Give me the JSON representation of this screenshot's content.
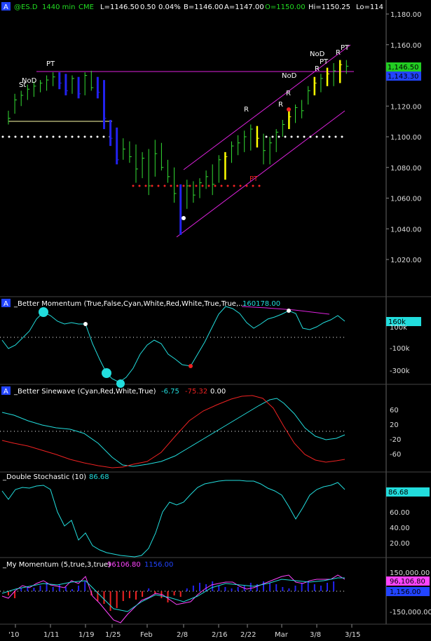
{
  "header": {
    "icon_letter": "A",
    "symbol": "@ES.D",
    "interval": "1440 min",
    "exchange": "CME",
    "last": "L=1146.50",
    "change": "0.50",
    "change_pct": "0.04%",
    "bid": "B=1146.00",
    "ask": "A=1147.00",
    "open": "O=1150.00",
    "high": "Hi=1150.25",
    "low": "Lo=114"
  },
  "colors": {
    "background": "#000000",
    "up_bar": "#33dd33",
    "down_bar": "#2222ee",
    "yellow_bar": "#ffff00",
    "channel": "#dd22dd",
    "cyan": "#22dddd",
    "red": "#ee2222",
    "magenta": "#ff44ff",
    "axis_text": "#dddddd",
    "blue_label": "#2244ff"
  },
  "price_axis": {
    "ticks": [
      "1,180.00",
      "1,160.00",
      "1,140.00",
      "1,120.00",
      "1,100.00",
      "1,080.00",
      "1,060.00",
      "1,040.00",
      "1,020.00"
    ]
  },
  "price_labels": {
    "last": "1,146.50",
    "second": "1,143.30"
  },
  "x_axis": {
    "ticks": [
      "'10",
      "1/11",
      "1/19",
      "1/25",
      "Feb",
      "2/8",
      "2/16",
      "2/22",
      "Mar",
      "3/8",
      "3/15"
    ]
  },
  "annotations": {
    "st": "St",
    "nod": "NoD",
    "pt": "PT",
    "r": "R",
    "pt_red": "PT"
  },
  "panels": {
    "momentum": {
      "title": "_Better Momentum (True,False,Cyan,White,Red,White,True,True,...",
      "value": "160178.00",
      "axis": [
        "100k",
        "-100k",
        "-300k"
      ],
      "last_label": "160k"
    },
    "sinewave": {
      "title": "_Better Sinewave (Cyan,Red,White,True)",
      "v1": "-6.75",
      "v2": "-75.32",
      "v3": "0.00",
      "axis": [
        "60",
        "20",
        "-20",
        "-60"
      ]
    },
    "stochastic": {
      "title": "_Double Stochastic (10)",
      "value": "86.68",
      "axis": [
        "60.00",
        "40.00",
        "20.00"
      ],
      "last_label": "86.68"
    },
    "my_momentum": {
      "title": "_My Momentum (5,true,3,true)",
      "v1": "96106.80",
      "v2": "1156.00",
      "axis": [
        "150,000.00",
        "-150,000.00"
      ],
      "label1": "96,106.80",
      "label2": "1,156.00"
    }
  },
  "chart_data": {
    "type": "candlestick",
    "x": [
      "'10",
      "",
      "",
      "",
      "",
      "",
      "",
      "1/11",
      "",
      "",
      "",
      "",
      "",
      "1/19",
      "",
      "",
      "",
      "1/25",
      "",
      "",
      "",
      "",
      "",
      "",
      "",
      "Feb",
      "",
      "",
      "",
      "",
      "2/8",
      "",
      "",
      "",
      "",
      "",
      "2/16",
      "",
      "",
      "",
      "2/22",
      "",
      "",
      "",
      "",
      "Mar",
      "",
      "",
      "",
      "3/8",
      "",
      "",
      "",
      "3/15"
    ],
    "bars": [
      [
        1117,
        1108,
        1112,
        "g"
      ],
      [
        1128,
        1115,
        1124,
        "g"
      ],
      [
        1130,
        1120,
        1127,
        "g"
      ],
      [
        1134,
        1124,
        1131,
        "g"
      ],
      [
        1136,
        1126,
        1133,
        "g"
      ],
      [
        1137,
        1129,
        1135,
        "g"
      ],
      [
        1140,
        1130,
        1137,
        "g"
      ],
      [
        1142,
        1133,
        1139,
        "g"
      ],
      [
        1142,
        1131,
        1135,
        "b"
      ],
      [
        1141,
        1127,
        1130,
        "b"
      ],
      [
        1140,
        1128,
        1138,
        "g"
      ],
      [
        1139,
        1125,
        1128,
        "b"
      ],
      [
        1142,
        1127,
        1140,
        "g"
      ],
      [
        1143,
        1130,
        1132,
        "g"
      ],
      [
        1139,
        1125,
        1129,
        "b"
      ],
      [
        1137,
        1105,
        1112,
        "b"
      ],
      [
        1111,
        1094,
        1099,
        "b"
      ],
      [
        1106,
        1082,
        1085,
        "b"
      ],
      [
        1099,
        1085,
        1092,
        "g"
      ],
      [
        1097,
        1083,
        1087,
        "g"
      ],
      [
        1095,
        1070,
        1079,
        "g"
      ],
      [
        1090,
        1073,
        1086,
        "g"
      ],
      [
        1092,
        1062,
        1068,
        "g"
      ],
      [
        1098,
        1074,
        1089,
        "g"
      ],
      [
        1096,
        1078,
        1080,
        "g"
      ],
      [
        1085,
        1070,
        1074,
        "g"
      ],
      [
        1080,
        1057,
        1063,
        "g"
      ],
      [
        1069,
        1036,
        1046,
        "b"
      ],
      [
        1072,
        1053,
        1068,
        "g"
      ],
      [
        1071,
        1057,
        1062,
        "g"
      ],
      [
        1073,
        1060,
        1070,
        "g"
      ],
      [
        1078,
        1066,
        1074,
        "g"
      ],
      [
        1082,
        1062,
        1069,
        "g"
      ],
      [
        1088,
        1070,
        1085,
        "g"
      ],
      [
        1090,
        1072,
        1087,
        "y"
      ],
      [
        1097,
        1083,
        1094,
        "g"
      ],
      [
        1101,
        1088,
        1096,
        "g"
      ],
      [
        1104,
        1090,
        1100,
        "g"
      ],
      [
        1108,
        1091,
        1105,
        "g"
      ],
      [
        1107,
        1093,
        1099,
        "y"
      ],
      [
        1102,
        1082,
        1091,
        "g"
      ],
      [
        1100,
        1082,
        1096,
        "g"
      ],
      [
        1105,
        1090,
        1103,
        "g"
      ],
      [
        1111,
        1100,
        1108,
        "g"
      ],
      [
        1117,
        1105,
        1113,
        "y"
      ],
      [
        1121,
        1109,
        1119,
        "g"
      ],
      [
        1124,
        1112,
        1117,
        "g"
      ],
      [
        1133,
        1121,
        1130,
        "g"
      ],
      [
        1139,
        1127,
        1135,
        "y"
      ],
      [
        1141,
        1129,
        1138,
        "g"
      ],
      [
        1145,
        1133,
        1141,
        "y"
      ],
      [
        1148,
        1133,
        1143,
        "g"
      ],
      [
        1150,
        1135,
        1147,
        "y"
      ],
      [
        1150,
        1141,
        1146,
        "g"
      ]
    ],
    "ylim": [
      1010,
      1190
    ]
  }
}
